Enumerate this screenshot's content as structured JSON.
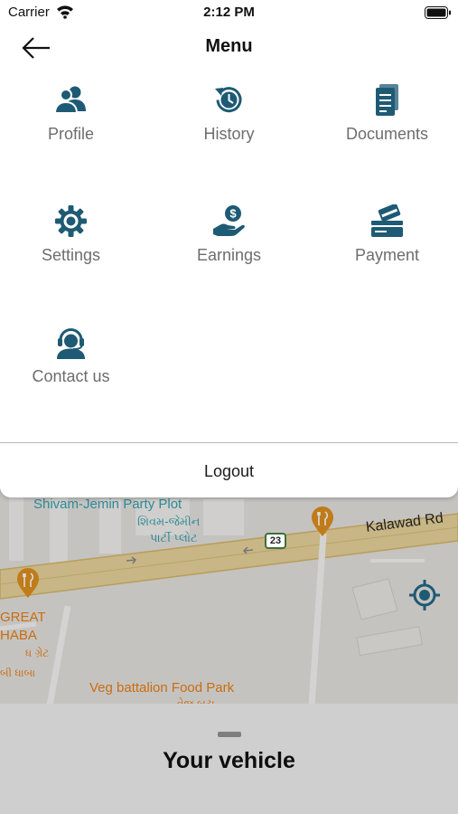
{
  "status_bar": {
    "carrier": "Carrier",
    "time": "2:12 PM",
    "wifi_icon": "wifi-icon",
    "battery_icon": "battery-icon"
  },
  "header": {
    "title": "Menu",
    "back_icon": "arrow-left-icon"
  },
  "menu": {
    "items": [
      {
        "label": "Profile",
        "icon": "profile-users-icon"
      },
      {
        "label": "History",
        "icon": "history-clock-icon"
      },
      {
        "label": "Documents",
        "icon": "document-icon"
      },
      {
        "label": "Settings",
        "icon": "gear-icon"
      },
      {
        "label": "Earnings",
        "icon": "money-hand-icon"
      },
      {
        "label": "Payment",
        "icon": "card-payment-icon"
      },
      {
        "label": "Contact us",
        "icon": "headset-support-icon"
      }
    ]
  },
  "logout": {
    "label": "Logout"
  },
  "map": {
    "labels": {
      "party_plot": "Shivam-Jemin Party Plot",
      "party_plot_guj_1": "શિવમ-જેમીન",
      "party_plot_guj_2": "પાર્ટી પ્લોટ",
      "road": "Kalawad Rd",
      "road_number": "23",
      "great_1": "GREAT",
      "great_2": "HABA",
      "great_3": "ધ ગ્રેટ",
      "great_4": "બી ધાબા",
      "veg": "Veg battalion Food Park",
      "veg_guj": "વેજ બટા"
    },
    "locate_icon": "crosshair-locate-icon",
    "poi_icon": "restaurant-pin-icon"
  },
  "bottom_sheet": {
    "title": "Your vehicle"
  },
  "colors": {
    "accent": "#1e5a74",
    "label_gray": "#6d6d6d",
    "map_road": "#e3c98a",
    "poi_orange": "#e0901f"
  }
}
